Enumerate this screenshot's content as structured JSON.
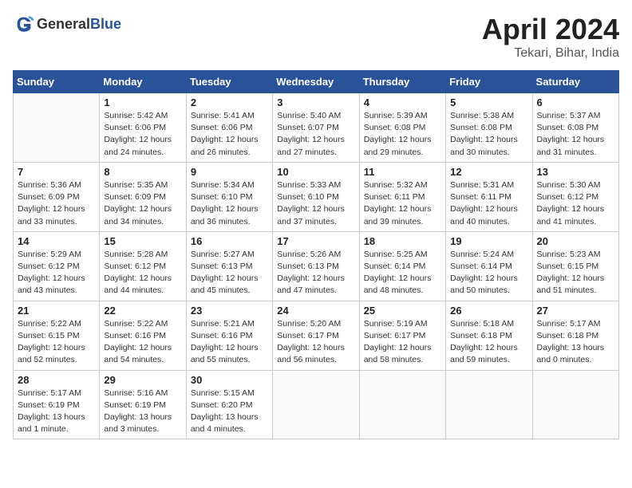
{
  "header": {
    "logo_general": "General",
    "logo_blue": "Blue",
    "month": "April 2024",
    "location": "Tekari, Bihar, India"
  },
  "weekdays": [
    "Sunday",
    "Monday",
    "Tuesday",
    "Wednesday",
    "Thursday",
    "Friday",
    "Saturday"
  ],
  "weeks": [
    [
      {
        "day": "",
        "info": ""
      },
      {
        "day": "1",
        "info": "Sunrise: 5:42 AM\nSunset: 6:06 PM\nDaylight: 12 hours\nand 24 minutes."
      },
      {
        "day": "2",
        "info": "Sunrise: 5:41 AM\nSunset: 6:06 PM\nDaylight: 12 hours\nand 26 minutes."
      },
      {
        "day": "3",
        "info": "Sunrise: 5:40 AM\nSunset: 6:07 PM\nDaylight: 12 hours\nand 27 minutes."
      },
      {
        "day": "4",
        "info": "Sunrise: 5:39 AM\nSunset: 6:08 PM\nDaylight: 12 hours\nand 29 minutes."
      },
      {
        "day": "5",
        "info": "Sunrise: 5:38 AM\nSunset: 6:08 PM\nDaylight: 12 hours\nand 30 minutes."
      },
      {
        "day": "6",
        "info": "Sunrise: 5:37 AM\nSunset: 6:08 PM\nDaylight: 12 hours\nand 31 minutes."
      }
    ],
    [
      {
        "day": "7",
        "info": "Sunrise: 5:36 AM\nSunset: 6:09 PM\nDaylight: 12 hours\nand 33 minutes."
      },
      {
        "day": "8",
        "info": "Sunrise: 5:35 AM\nSunset: 6:09 PM\nDaylight: 12 hours\nand 34 minutes."
      },
      {
        "day": "9",
        "info": "Sunrise: 5:34 AM\nSunset: 6:10 PM\nDaylight: 12 hours\nand 36 minutes."
      },
      {
        "day": "10",
        "info": "Sunrise: 5:33 AM\nSunset: 6:10 PM\nDaylight: 12 hours\nand 37 minutes."
      },
      {
        "day": "11",
        "info": "Sunrise: 5:32 AM\nSunset: 6:11 PM\nDaylight: 12 hours\nand 39 minutes."
      },
      {
        "day": "12",
        "info": "Sunrise: 5:31 AM\nSunset: 6:11 PM\nDaylight: 12 hours\nand 40 minutes."
      },
      {
        "day": "13",
        "info": "Sunrise: 5:30 AM\nSunset: 6:12 PM\nDaylight: 12 hours\nand 41 minutes."
      }
    ],
    [
      {
        "day": "14",
        "info": "Sunrise: 5:29 AM\nSunset: 6:12 PM\nDaylight: 12 hours\nand 43 minutes."
      },
      {
        "day": "15",
        "info": "Sunrise: 5:28 AM\nSunset: 6:12 PM\nDaylight: 12 hours\nand 44 minutes."
      },
      {
        "day": "16",
        "info": "Sunrise: 5:27 AM\nSunset: 6:13 PM\nDaylight: 12 hours\nand 45 minutes."
      },
      {
        "day": "17",
        "info": "Sunrise: 5:26 AM\nSunset: 6:13 PM\nDaylight: 12 hours\nand 47 minutes."
      },
      {
        "day": "18",
        "info": "Sunrise: 5:25 AM\nSunset: 6:14 PM\nDaylight: 12 hours\nand 48 minutes."
      },
      {
        "day": "19",
        "info": "Sunrise: 5:24 AM\nSunset: 6:14 PM\nDaylight: 12 hours\nand 50 minutes."
      },
      {
        "day": "20",
        "info": "Sunrise: 5:23 AM\nSunset: 6:15 PM\nDaylight: 12 hours\nand 51 minutes."
      }
    ],
    [
      {
        "day": "21",
        "info": "Sunrise: 5:22 AM\nSunset: 6:15 PM\nDaylight: 12 hours\nand 52 minutes."
      },
      {
        "day": "22",
        "info": "Sunrise: 5:22 AM\nSunset: 6:16 PM\nDaylight: 12 hours\nand 54 minutes."
      },
      {
        "day": "23",
        "info": "Sunrise: 5:21 AM\nSunset: 6:16 PM\nDaylight: 12 hours\nand 55 minutes."
      },
      {
        "day": "24",
        "info": "Sunrise: 5:20 AM\nSunset: 6:17 PM\nDaylight: 12 hours\nand 56 minutes."
      },
      {
        "day": "25",
        "info": "Sunrise: 5:19 AM\nSunset: 6:17 PM\nDaylight: 12 hours\nand 58 minutes."
      },
      {
        "day": "26",
        "info": "Sunrise: 5:18 AM\nSunset: 6:18 PM\nDaylight: 12 hours\nand 59 minutes."
      },
      {
        "day": "27",
        "info": "Sunrise: 5:17 AM\nSunset: 6:18 PM\nDaylight: 13 hours\nand 0 minutes."
      }
    ],
    [
      {
        "day": "28",
        "info": "Sunrise: 5:17 AM\nSunset: 6:19 PM\nDaylight: 13 hours\nand 1 minute."
      },
      {
        "day": "29",
        "info": "Sunrise: 5:16 AM\nSunset: 6:19 PM\nDaylight: 13 hours\nand 3 minutes."
      },
      {
        "day": "30",
        "info": "Sunrise: 5:15 AM\nSunset: 6:20 PM\nDaylight: 13 hours\nand 4 minutes."
      },
      {
        "day": "",
        "info": ""
      },
      {
        "day": "",
        "info": ""
      },
      {
        "day": "",
        "info": ""
      },
      {
        "day": "",
        "info": ""
      }
    ]
  ]
}
